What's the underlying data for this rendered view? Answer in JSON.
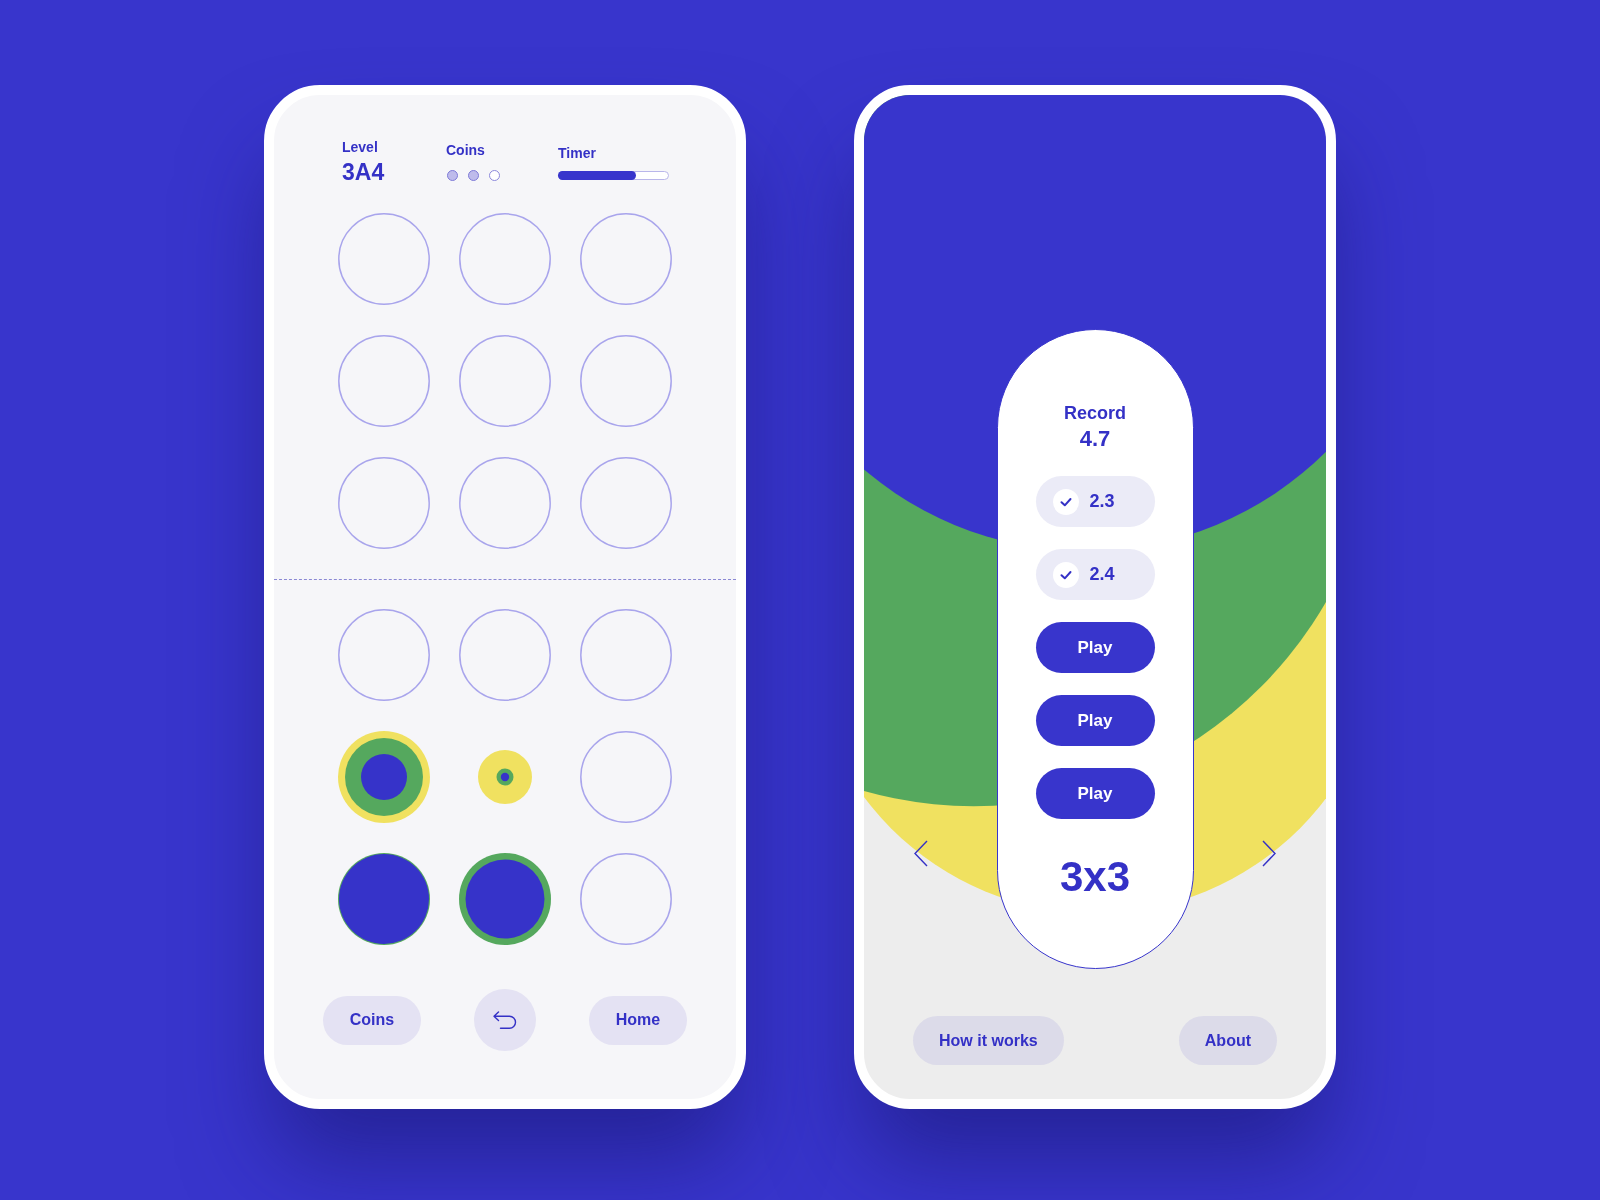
{
  "left_screen": {
    "header": {
      "level": {
        "label": "Level",
        "value": "3A4"
      },
      "coins": {
        "label": "Coins",
        "dots": [
          {
            "filled": true
          },
          {
            "filled": true
          },
          {
            "filled": false
          }
        ]
      },
      "timer": {
        "label": "Timer",
        "level": 0.7
      }
    },
    "top_grid": [
      {
        "kind": "empty"
      },
      {
        "kind": "empty"
      },
      {
        "kind": "empty"
      },
      {
        "kind": "empty"
      },
      {
        "kind": "empty"
      },
      {
        "kind": "empty"
      },
      {
        "kind": "empty"
      },
      {
        "kind": "empty"
      },
      {
        "kind": "empty"
      }
    ],
    "bottom_grid": [
      {
        "kind": "empty"
      },
      {
        "kind": "empty"
      },
      {
        "kind": "empty"
      },
      {
        "kind": "target"
      },
      {
        "kind": "dot"
      },
      {
        "kind": "empty"
      },
      {
        "kind": "disc"
      },
      {
        "kind": "ring"
      },
      {
        "kind": "empty"
      }
    ],
    "buttons": [
      {
        "kind": "text",
        "label": "Coins"
      },
      {
        "kind": "back"
      },
      {
        "kind": "text",
        "label": "Home"
      }
    ]
  },
  "right_screen": {
    "record": {
      "label": "Record",
      "value": "4.7"
    },
    "entries": [
      {
        "kind": "result",
        "label": "2.3"
      },
      {
        "kind": "result",
        "label": "2.4"
      },
      {
        "kind": "play",
        "label": "Play"
      },
      {
        "kind": "play",
        "label": "Play"
      },
      {
        "kind": "play",
        "label": "Play"
      }
    ],
    "board_size": "3x3",
    "buttons": [
      {
        "label": "How it works"
      },
      {
        "label": "About"
      }
    ]
  }
}
